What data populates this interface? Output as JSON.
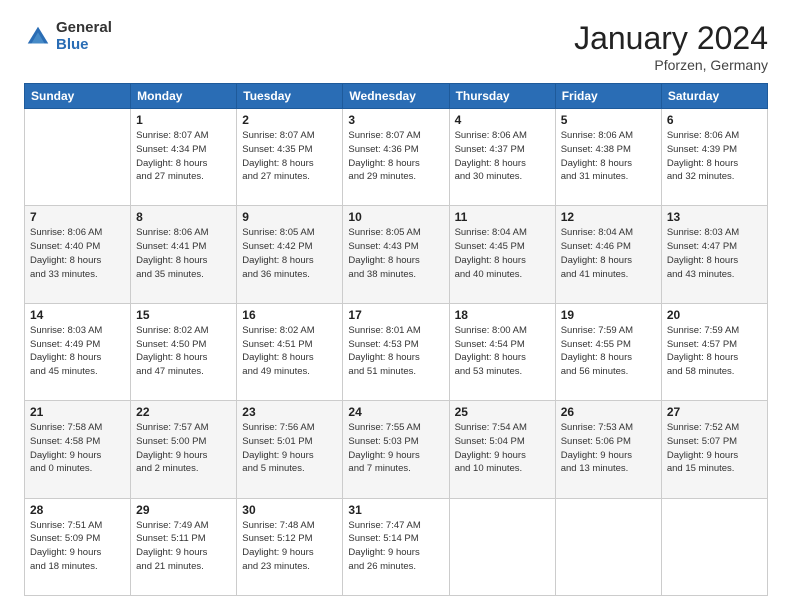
{
  "logo": {
    "general": "General",
    "blue": "Blue"
  },
  "header": {
    "month": "January 2024",
    "location": "Pforzen, Germany"
  },
  "weekdays": [
    "Sunday",
    "Monday",
    "Tuesday",
    "Wednesday",
    "Thursday",
    "Friday",
    "Saturday"
  ],
  "weeks": [
    [
      {
        "day": "",
        "info": ""
      },
      {
        "day": "1",
        "info": "Sunrise: 8:07 AM\nSunset: 4:34 PM\nDaylight: 8 hours\nand 27 minutes."
      },
      {
        "day": "2",
        "info": "Sunrise: 8:07 AM\nSunset: 4:35 PM\nDaylight: 8 hours\nand 27 minutes."
      },
      {
        "day": "3",
        "info": "Sunrise: 8:07 AM\nSunset: 4:36 PM\nDaylight: 8 hours\nand 29 minutes."
      },
      {
        "day": "4",
        "info": "Sunrise: 8:06 AM\nSunset: 4:37 PM\nDaylight: 8 hours\nand 30 minutes."
      },
      {
        "day": "5",
        "info": "Sunrise: 8:06 AM\nSunset: 4:38 PM\nDaylight: 8 hours\nand 31 minutes."
      },
      {
        "day": "6",
        "info": "Sunrise: 8:06 AM\nSunset: 4:39 PM\nDaylight: 8 hours\nand 32 minutes."
      }
    ],
    [
      {
        "day": "7",
        "info": "Sunrise: 8:06 AM\nSunset: 4:40 PM\nDaylight: 8 hours\nand 33 minutes."
      },
      {
        "day": "8",
        "info": "Sunrise: 8:06 AM\nSunset: 4:41 PM\nDaylight: 8 hours\nand 35 minutes."
      },
      {
        "day": "9",
        "info": "Sunrise: 8:05 AM\nSunset: 4:42 PM\nDaylight: 8 hours\nand 36 minutes."
      },
      {
        "day": "10",
        "info": "Sunrise: 8:05 AM\nSunset: 4:43 PM\nDaylight: 8 hours\nand 38 minutes."
      },
      {
        "day": "11",
        "info": "Sunrise: 8:04 AM\nSunset: 4:45 PM\nDaylight: 8 hours\nand 40 minutes."
      },
      {
        "day": "12",
        "info": "Sunrise: 8:04 AM\nSunset: 4:46 PM\nDaylight: 8 hours\nand 41 minutes."
      },
      {
        "day": "13",
        "info": "Sunrise: 8:03 AM\nSunset: 4:47 PM\nDaylight: 8 hours\nand 43 minutes."
      }
    ],
    [
      {
        "day": "14",
        "info": "Sunrise: 8:03 AM\nSunset: 4:49 PM\nDaylight: 8 hours\nand 45 minutes."
      },
      {
        "day": "15",
        "info": "Sunrise: 8:02 AM\nSunset: 4:50 PM\nDaylight: 8 hours\nand 47 minutes."
      },
      {
        "day": "16",
        "info": "Sunrise: 8:02 AM\nSunset: 4:51 PM\nDaylight: 8 hours\nand 49 minutes."
      },
      {
        "day": "17",
        "info": "Sunrise: 8:01 AM\nSunset: 4:53 PM\nDaylight: 8 hours\nand 51 minutes."
      },
      {
        "day": "18",
        "info": "Sunrise: 8:00 AM\nSunset: 4:54 PM\nDaylight: 8 hours\nand 53 minutes."
      },
      {
        "day": "19",
        "info": "Sunrise: 7:59 AM\nSunset: 4:55 PM\nDaylight: 8 hours\nand 56 minutes."
      },
      {
        "day": "20",
        "info": "Sunrise: 7:59 AM\nSunset: 4:57 PM\nDaylight: 8 hours\nand 58 minutes."
      }
    ],
    [
      {
        "day": "21",
        "info": "Sunrise: 7:58 AM\nSunset: 4:58 PM\nDaylight: 9 hours\nand 0 minutes."
      },
      {
        "day": "22",
        "info": "Sunrise: 7:57 AM\nSunset: 5:00 PM\nDaylight: 9 hours\nand 2 minutes."
      },
      {
        "day": "23",
        "info": "Sunrise: 7:56 AM\nSunset: 5:01 PM\nDaylight: 9 hours\nand 5 minutes."
      },
      {
        "day": "24",
        "info": "Sunrise: 7:55 AM\nSunset: 5:03 PM\nDaylight: 9 hours\nand 7 minutes."
      },
      {
        "day": "25",
        "info": "Sunrise: 7:54 AM\nSunset: 5:04 PM\nDaylight: 9 hours\nand 10 minutes."
      },
      {
        "day": "26",
        "info": "Sunrise: 7:53 AM\nSunset: 5:06 PM\nDaylight: 9 hours\nand 13 minutes."
      },
      {
        "day": "27",
        "info": "Sunrise: 7:52 AM\nSunset: 5:07 PM\nDaylight: 9 hours\nand 15 minutes."
      }
    ],
    [
      {
        "day": "28",
        "info": "Sunrise: 7:51 AM\nSunset: 5:09 PM\nDaylight: 9 hours\nand 18 minutes."
      },
      {
        "day": "29",
        "info": "Sunrise: 7:49 AM\nSunset: 5:11 PM\nDaylight: 9 hours\nand 21 minutes."
      },
      {
        "day": "30",
        "info": "Sunrise: 7:48 AM\nSunset: 5:12 PM\nDaylight: 9 hours\nand 23 minutes."
      },
      {
        "day": "31",
        "info": "Sunrise: 7:47 AM\nSunset: 5:14 PM\nDaylight: 9 hours\nand 26 minutes."
      },
      {
        "day": "",
        "info": ""
      },
      {
        "day": "",
        "info": ""
      },
      {
        "day": "",
        "info": ""
      }
    ]
  ]
}
